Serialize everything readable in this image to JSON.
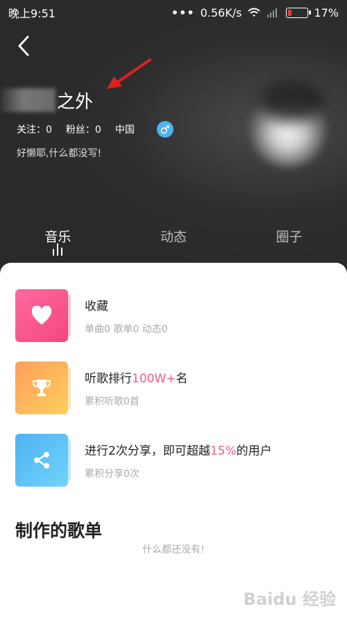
{
  "status_bar": {
    "time": "晚上9:51",
    "dots": "•••",
    "speed": "0.56K/s",
    "battery": "17%"
  },
  "profile": {
    "name": "之外",
    "following": "关注：0",
    "followers": "粉丝：0",
    "region": "中国",
    "gender_symbol": "♂",
    "signature": "好懒耶,什么都没写!"
  },
  "tabs": [
    {
      "label": "音乐",
      "active": true
    },
    {
      "label": "动态",
      "active": false
    },
    {
      "label": "圈子",
      "active": false
    }
  ],
  "items": [
    {
      "title": "收藏",
      "sub": "单曲0 歌单0 动态0",
      "icon": "heart-icon",
      "color": "#f25c8c"
    },
    {
      "title_pre": "听歌排行",
      "title_hl": "100W+",
      "title_post": "名",
      "sub": "累积听歌0首",
      "icon": "trophy-icon",
      "color": "#fdb54c"
    },
    {
      "title_pre": "进行2次分享，即可超越",
      "title_hl": "15%",
      "title_post": "的用户",
      "sub": "累积分享0次",
      "icon": "share-icon",
      "color": "#57c1f4"
    }
  ],
  "playlist_section": {
    "title": "制作的歌单",
    "empty": "什么都还没有!"
  },
  "watermark": "Baidu 经验",
  "colors": {
    "accent": "#ee5d85",
    "gender_badge": "#4fb3f0",
    "arrow": "#e02020"
  }
}
